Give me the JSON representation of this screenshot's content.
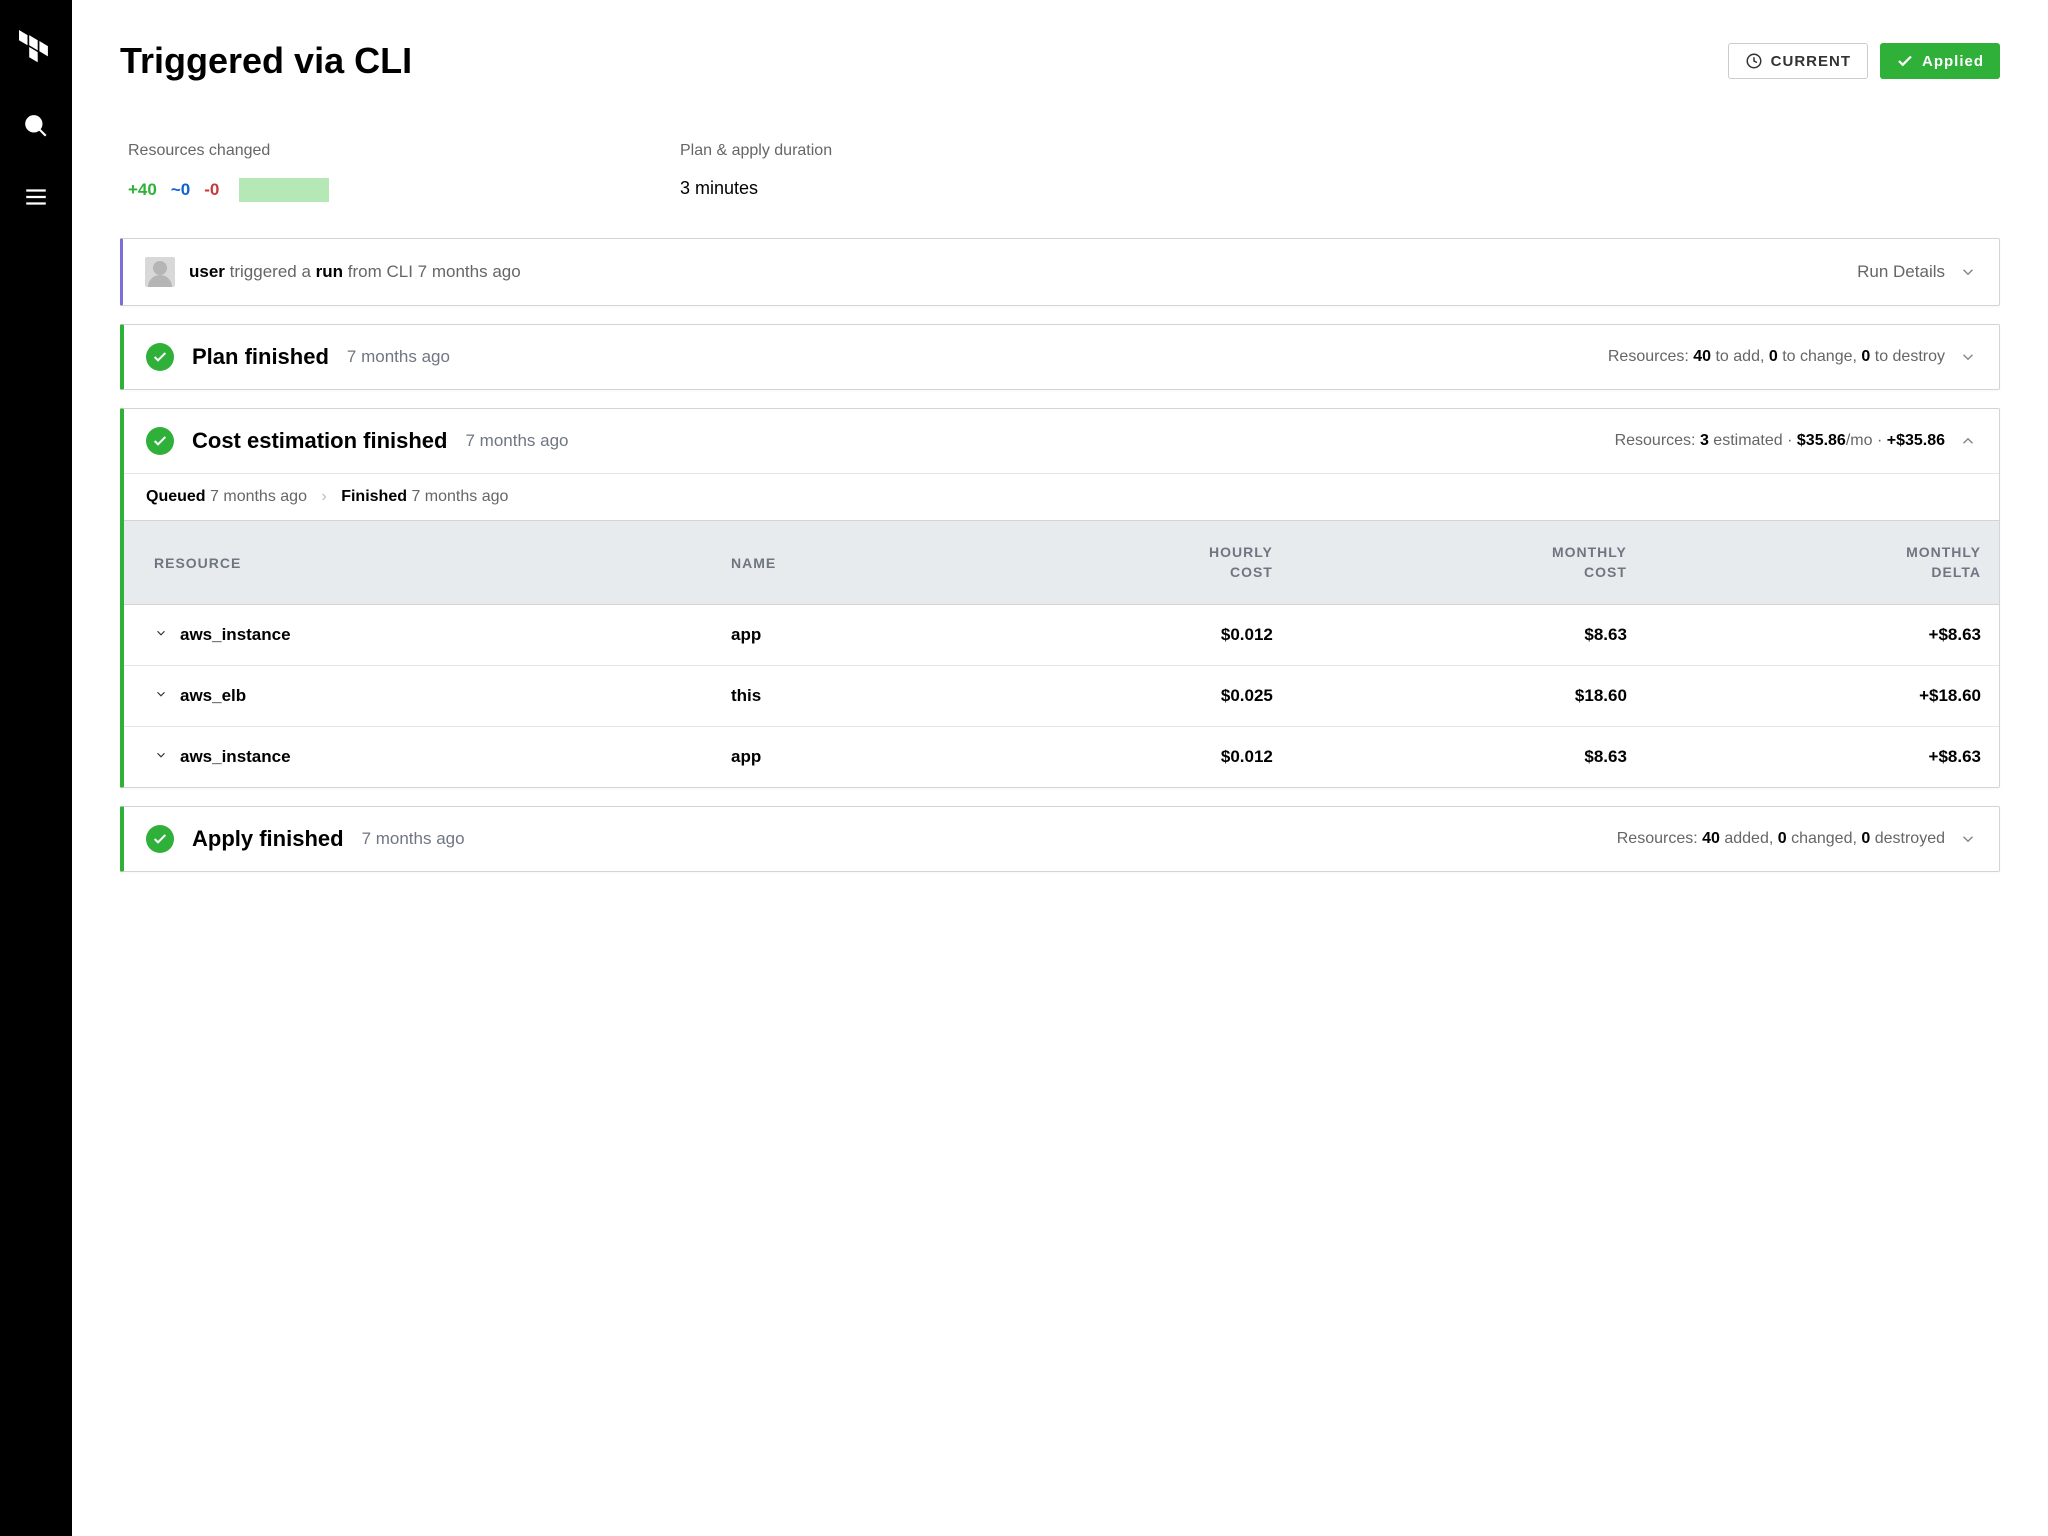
{
  "header": {
    "title": "Triggered via CLI",
    "current_label": "CURRENT",
    "applied_label": "Applied"
  },
  "meta": {
    "resources_changed_label": "Resources changed",
    "added": "+40",
    "changed": "~0",
    "destroyed": "-0",
    "duration_label": "Plan & apply duration",
    "duration_value": "3 minutes"
  },
  "trigger": {
    "user": "user",
    "text_mid": " triggered a ",
    "run": "run",
    "text_tail": " from CLI 7 months ago",
    "details_label": "Run Details"
  },
  "plan": {
    "title": "Plan finished",
    "time": "7 months ago",
    "summary_prefix": "Resources: ",
    "add_n": "40",
    "add_t": " to add, ",
    "chg_n": "0",
    "chg_t": " to change, ",
    "des_n": "0",
    "des_t": " to destroy"
  },
  "cost": {
    "title": "Cost estimation finished",
    "time": "7 months ago",
    "summary_prefix": "Resources: ",
    "est_n": "3",
    "est_t": " estimated · ",
    "mo_n": "$35.86",
    "mo_t": "/mo · ",
    "delta_n": "+$35.86",
    "breadcrumb": {
      "queued": "Queued",
      "queued_time": "7 months ago",
      "finished": "Finished",
      "finished_time": "7 months ago"
    },
    "columns": {
      "resource": "RESOURCE",
      "name": "NAME",
      "hourly_l1": "HOURLY",
      "hourly_l2": "COST",
      "monthly_l1": "MONTHLY",
      "monthly_l2": "COST",
      "delta_l1": "MONTHLY",
      "delta_l2": "DELTA"
    },
    "rows": [
      {
        "resource": "aws_instance",
        "name": "app",
        "hourly": "$0.012",
        "monthly": "$8.63",
        "delta": "+$8.63"
      },
      {
        "resource": "aws_elb",
        "name": "this",
        "hourly": "$0.025",
        "monthly": "$18.60",
        "delta": "+$18.60"
      },
      {
        "resource": "aws_instance",
        "name": "app",
        "hourly": "$0.012",
        "monthly": "$8.63",
        "delta": "+$8.63"
      }
    ]
  },
  "apply": {
    "title": "Apply finished",
    "time": "7 months ago",
    "summary_prefix": "Resources: ",
    "add_n": "40",
    "add_t": " added, ",
    "chg_n": "0",
    "chg_t": " changed, ",
    "des_n": "0",
    "des_t": " destroyed"
  }
}
